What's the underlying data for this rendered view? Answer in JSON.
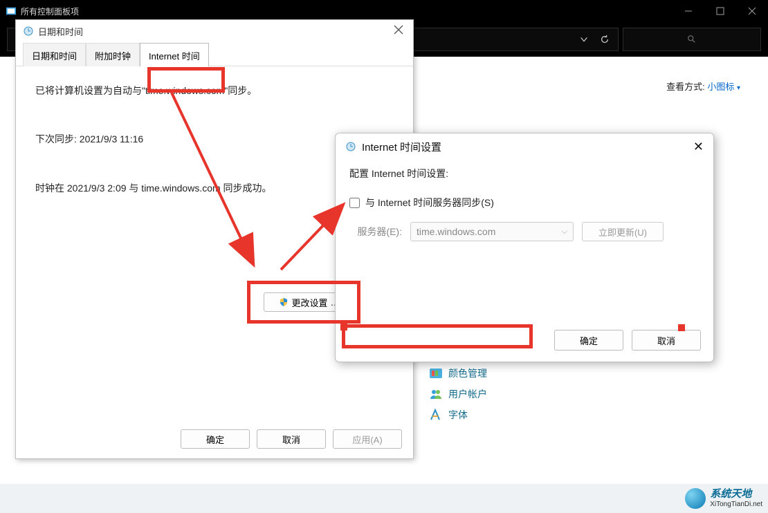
{
  "main_window": {
    "title": "所有控制面板项",
    "view_mode_label": "查看方式:",
    "view_mode_value": "小图标",
    "control_panel_items": [
      {
        "label": "颜色管理",
        "icon": "color-icon"
      },
      {
        "label": "用户帐户",
        "icon": "users-icon"
      },
      {
        "label": "字体",
        "icon": "font-icon"
      }
    ]
  },
  "date_time_dialog": {
    "title": "日期和时间",
    "tabs": [
      {
        "label": "日期和时间",
        "active": false
      },
      {
        "label": "附加时钟",
        "active": false
      },
      {
        "label": "Internet 时间",
        "active": true
      }
    ],
    "sync_status": "已将计算机设置为自动与\"time.windows.com\"同步。",
    "next_sync": "下次同步: 2021/9/3 11:16",
    "last_success": "时钟在 2021/9/3 2:09 与 time.windows.com 同步成功。",
    "change_settings_btn": "更改设置",
    "buttons": {
      "ok": "确定",
      "cancel": "取消",
      "apply": "应用(A)"
    }
  },
  "internet_time_settings": {
    "title": "Internet 时间设置",
    "config_label": "配置 Internet 时间设置:",
    "checkbox_label": "与 Internet 时间服务器同步(S)",
    "server_label": "服务器(E):",
    "server_value": "time.windows.com",
    "update_now": "立即更新(U)",
    "buttons": {
      "ok": "确定",
      "cancel": "取消"
    }
  },
  "watermark": {
    "line1": "系统天地",
    "line2": "XiTongTianDi.net"
  }
}
